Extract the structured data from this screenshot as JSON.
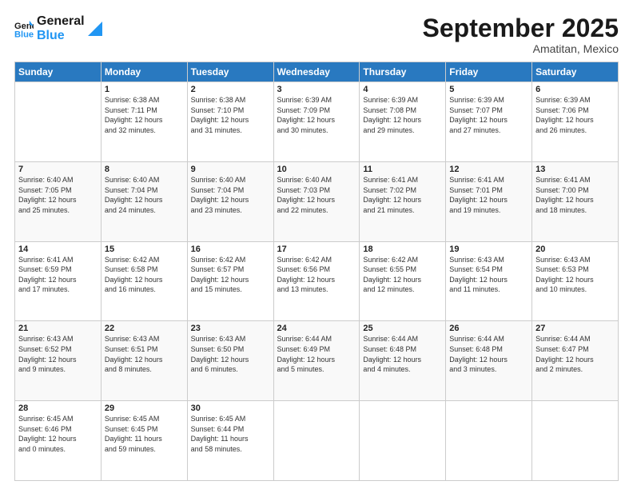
{
  "logo": {
    "line1": "General",
    "line2": "Blue"
  },
  "title": "September 2025",
  "location": "Amatitan, Mexico",
  "days_header": [
    "Sunday",
    "Monday",
    "Tuesday",
    "Wednesday",
    "Thursday",
    "Friday",
    "Saturday"
  ],
  "weeks": [
    [
      {
        "day": "",
        "info": ""
      },
      {
        "day": "1",
        "info": "Sunrise: 6:38 AM\nSunset: 7:11 PM\nDaylight: 12 hours\nand 32 minutes."
      },
      {
        "day": "2",
        "info": "Sunrise: 6:38 AM\nSunset: 7:10 PM\nDaylight: 12 hours\nand 31 minutes."
      },
      {
        "day": "3",
        "info": "Sunrise: 6:39 AM\nSunset: 7:09 PM\nDaylight: 12 hours\nand 30 minutes."
      },
      {
        "day": "4",
        "info": "Sunrise: 6:39 AM\nSunset: 7:08 PM\nDaylight: 12 hours\nand 29 minutes."
      },
      {
        "day": "5",
        "info": "Sunrise: 6:39 AM\nSunset: 7:07 PM\nDaylight: 12 hours\nand 27 minutes."
      },
      {
        "day": "6",
        "info": "Sunrise: 6:39 AM\nSunset: 7:06 PM\nDaylight: 12 hours\nand 26 minutes."
      }
    ],
    [
      {
        "day": "7",
        "info": "Sunrise: 6:40 AM\nSunset: 7:05 PM\nDaylight: 12 hours\nand 25 minutes."
      },
      {
        "day": "8",
        "info": "Sunrise: 6:40 AM\nSunset: 7:04 PM\nDaylight: 12 hours\nand 24 minutes."
      },
      {
        "day": "9",
        "info": "Sunrise: 6:40 AM\nSunset: 7:04 PM\nDaylight: 12 hours\nand 23 minutes."
      },
      {
        "day": "10",
        "info": "Sunrise: 6:40 AM\nSunset: 7:03 PM\nDaylight: 12 hours\nand 22 minutes."
      },
      {
        "day": "11",
        "info": "Sunrise: 6:41 AM\nSunset: 7:02 PM\nDaylight: 12 hours\nand 21 minutes."
      },
      {
        "day": "12",
        "info": "Sunrise: 6:41 AM\nSunset: 7:01 PM\nDaylight: 12 hours\nand 19 minutes."
      },
      {
        "day": "13",
        "info": "Sunrise: 6:41 AM\nSunset: 7:00 PM\nDaylight: 12 hours\nand 18 minutes."
      }
    ],
    [
      {
        "day": "14",
        "info": "Sunrise: 6:41 AM\nSunset: 6:59 PM\nDaylight: 12 hours\nand 17 minutes."
      },
      {
        "day": "15",
        "info": "Sunrise: 6:42 AM\nSunset: 6:58 PM\nDaylight: 12 hours\nand 16 minutes."
      },
      {
        "day": "16",
        "info": "Sunrise: 6:42 AM\nSunset: 6:57 PM\nDaylight: 12 hours\nand 15 minutes."
      },
      {
        "day": "17",
        "info": "Sunrise: 6:42 AM\nSunset: 6:56 PM\nDaylight: 12 hours\nand 13 minutes."
      },
      {
        "day": "18",
        "info": "Sunrise: 6:42 AM\nSunset: 6:55 PM\nDaylight: 12 hours\nand 12 minutes."
      },
      {
        "day": "19",
        "info": "Sunrise: 6:43 AM\nSunset: 6:54 PM\nDaylight: 12 hours\nand 11 minutes."
      },
      {
        "day": "20",
        "info": "Sunrise: 6:43 AM\nSunset: 6:53 PM\nDaylight: 12 hours\nand 10 minutes."
      }
    ],
    [
      {
        "day": "21",
        "info": "Sunrise: 6:43 AM\nSunset: 6:52 PM\nDaylight: 12 hours\nand 9 minutes."
      },
      {
        "day": "22",
        "info": "Sunrise: 6:43 AM\nSunset: 6:51 PM\nDaylight: 12 hours\nand 8 minutes."
      },
      {
        "day": "23",
        "info": "Sunrise: 6:43 AM\nSunset: 6:50 PM\nDaylight: 12 hours\nand 6 minutes."
      },
      {
        "day": "24",
        "info": "Sunrise: 6:44 AM\nSunset: 6:49 PM\nDaylight: 12 hours\nand 5 minutes."
      },
      {
        "day": "25",
        "info": "Sunrise: 6:44 AM\nSunset: 6:48 PM\nDaylight: 12 hours\nand 4 minutes."
      },
      {
        "day": "26",
        "info": "Sunrise: 6:44 AM\nSunset: 6:48 PM\nDaylight: 12 hours\nand 3 minutes."
      },
      {
        "day": "27",
        "info": "Sunrise: 6:44 AM\nSunset: 6:47 PM\nDaylight: 12 hours\nand 2 minutes."
      }
    ],
    [
      {
        "day": "28",
        "info": "Sunrise: 6:45 AM\nSunset: 6:46 PM\nDaylight: 12 hours\nand 0 minutes."
      },
      {
        "day": "29",
        "info": "Sunrise: 6:45 AM\nSunset: 6:45 PM\nDaylight: 11 hours\nand 59 minutes."
      },
      {
        "day": "30",
        "info": "Sunrise: 6:45 AM\nSunset: 6:44 PM\nDaylight: 11 hours\nand 58 minutes."
      },
      {
        "day": "",
        "info": ""
      },
      {
        "day": "",
        "info": ""
      },
      {
        "day": "",
        "info": ""
      },
      {
        "day": "",
        "info": ""
      }
    ]
  ]
}
